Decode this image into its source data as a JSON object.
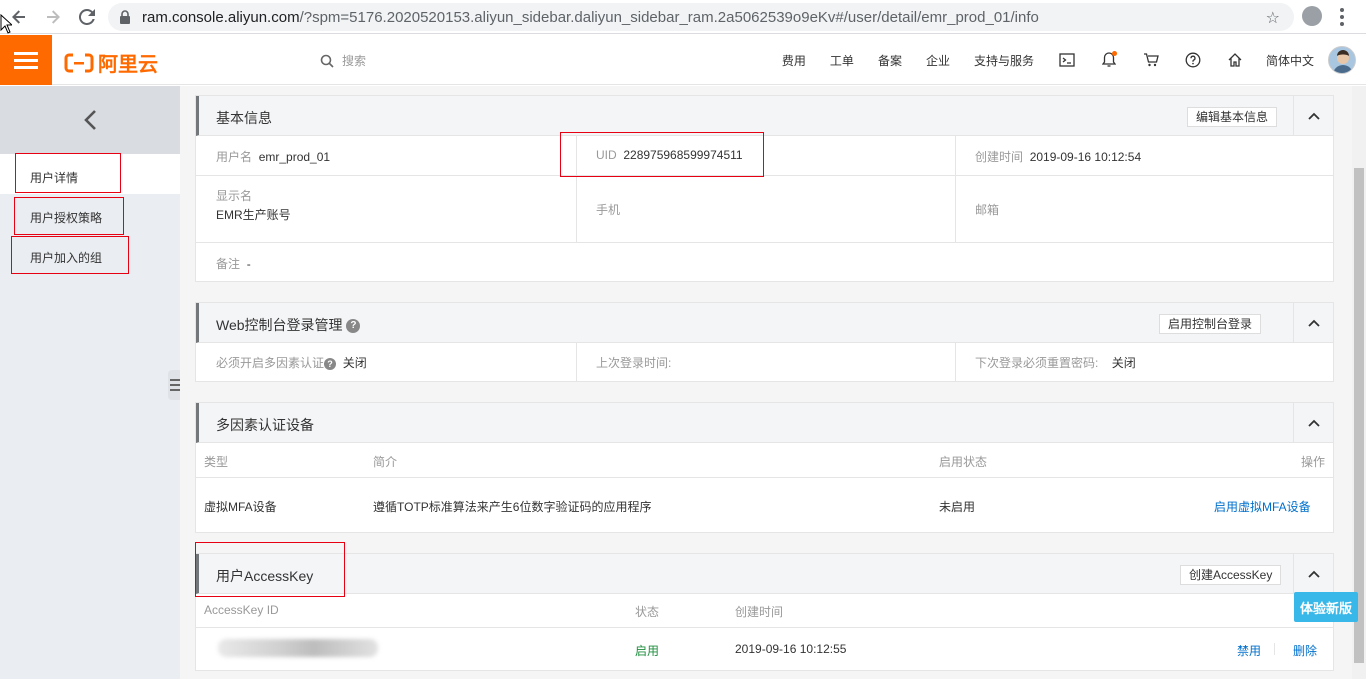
{
  "browser": {
    "url_host": "ram.console.aliyun.com",
    "url_path": "/?spm=5176.2020520153.aliyun_sidebar.daliyun_sidebar_ram.2a5062539o9eKv#/user/detail/emr_prod_01/info"
  },
  "topnav": {
    "logo_text": "阿里云",
    "search_placeholder": "搜索",
    "items": [
      "费用",
      "工单",
      "备案",
      "企业",
      "支持与服务"
    ],
    "lang": "简体中文",
    "icons": [
      "terminal-icon",
      "bell-icon",
      "cart-icon",
      "help-icon",
      "home-icon"
    ]
  },
  "sidebar": {
    "items": [
      "用户详情",
      "用户授权策略",
      "用户加入的组"
    ]
  },
  "basic_info": {
    "title": "基本信息",
    "edit_button": "编辑基本信息",
    "username_label": "用户名",
    "username": "emr_prod_01",
    "uid_label": "UID",
    "uid": "228975968599974511",
    "created_label": "创建时间",
    "created": "2019-09-16 10:12:54",
    "display_name_label": "显示名",
    "display_name": "EMR生产账号",
    "phone_label": "手机",
    "email_label": "邮箱",
    "remark_label": "备注",
    "remark": "-"
  },
  "web_console": {
    "title": "Web控制台登录管理",
    "enable_button": "启用控制台登录",
    "mfa_label": "必须开启多因素认证",
    "mfa_value": "关闭",
    "last_login_label": "上次登录时间:",
    "reset_pwd_label": "下次登录必须重置密码:",
    "reset_pwd_value": "关闭"
  },
  "mfa": {
    "title": "多因素认证设备",
    "columns": [
      "类型",
      "简介",
      "启用状态",
      "操作"
    ],
    "row": {
      "type": "虚拟MFA设备",
      "desc": "遵循TOTP标准算法来产生6位数字验证码的应用程序",
      "status": "未启用",
      "action": "启用虚拟MFA设备"
    }
  },
  "accesskey": {
    "title": "用户AccessKey",
    "create_button": "创建AccessKey",
    "columns": [
      "AccessKey ID",
      "状态",
      "创建时间"
    ],
    "row": {
      "status": "启用",
      "created": "2019-09-16 10:12:55",
      "disable": "禁用",
      "delete": "删除"
    }
  },
  "try_new": "体验新版",
  "colors": {
    "brand": "#ff6a00",
    "link": "#0070cc",
    "success": "#1e8e3e",
    "highlight_box": "#e60012"
  }
}
